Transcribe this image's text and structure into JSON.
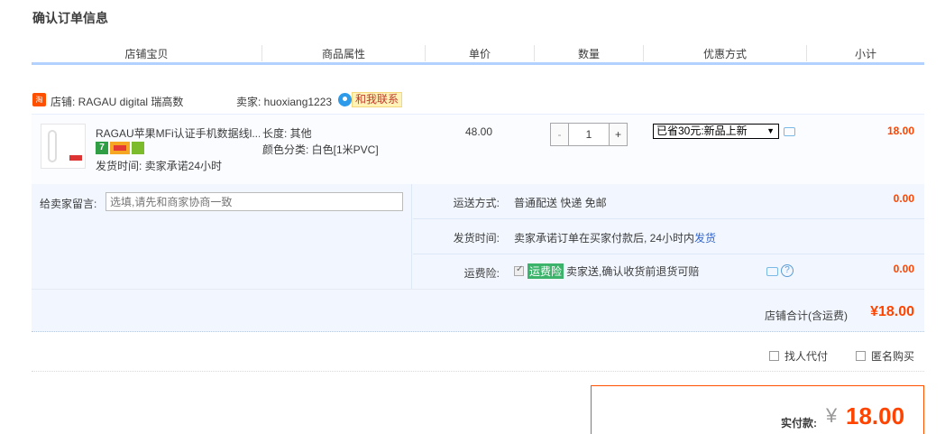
{
  "page_title": "确认订单信息",
  "columns": [
    "店铺宝贝",
    "商品属性",
    "单价",
    "数量",
    "优惠方式",
    "小计"
  ],
  "shop": {
    "shop_icon_text": "淘",
    "shop_label": "店铺: RAGAU digital 瑞高数",
    "seller_label": "卖家: huoxiang1223",
    "contact_label": "和我联系"
  },
  "item": {
    "title": "RAGAU苹果MFi认证手机数据线l...",
    "badge_7": "7",
    "ship_time": "发货时间: 卖家承诺24小时",
    "attr_length": "长度: 其他",
    "attr_color": "颜色分类: 白色[1米PVC]",
    "unit_price": "48.00",
    "qty_minus": "-",
    "qty_plus": "+",
    "quantity": "1",
    "promo_selected": "已省30元:新品上新",
    "subtotal": "18.00"
  },
  "message": {
    "label": "给卖家留言:",
    "placeholder": "选填,请先和商家协商一致"
  },
  "shipping": {
    "method_label": "运送方式:",
    "method_value": "普通配送 快递 免邮",
    "method_amount": "0.00",
    "time_label": "发货时间:",
    "time_value": "卖家承诺订单在买家付款后, 24小时内",
    "time_link": "发货",
    "insurance_label": "运费险:",
    "insurance_tag": "运费险",
    "insurance_value": "卖家送,确认收货前退货可赔",
    "insurance_amount": "0.00",
    "help_glyph": "?"
  },
  "shop_total": {
    "label": "店铺合计(含运费)",
    "amount": "¥18.00"
  },
  "options": {
    "agent_pay": "找人代付",
    "anonymous": "匿名购买"
  },
  "payment": {
    "label": "实付款:",
    "currency": "¥",
    "amount": "18.00"
  },
  "colors": {
    "accent": "#ff5000",
    "header_border": "#b2d1ff",
    "panel_bg": "#f2f7ff",
    "link": "#3366cc"
  }
}
